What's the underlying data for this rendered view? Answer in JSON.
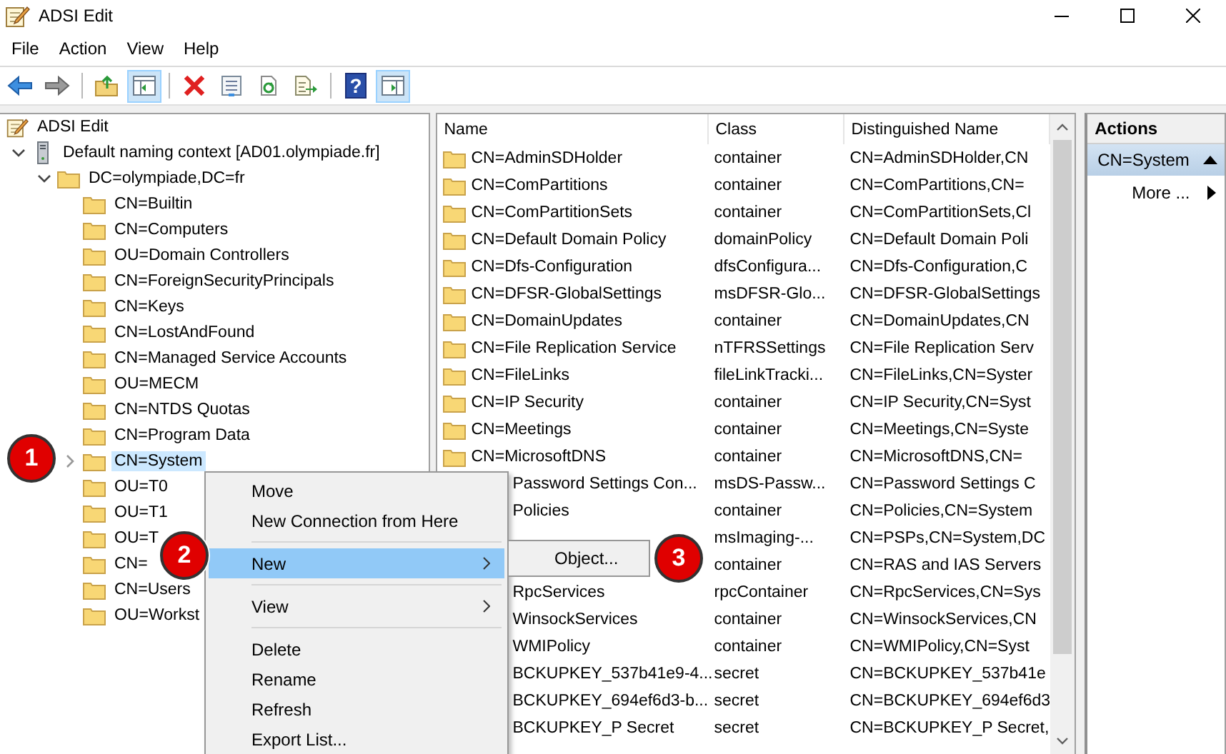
{
  "window": {
    "title": "ADSI Edit"
  },
  "menu_bar": [
    "File",
    "Action",
    "View",
    "Help"
  ],
  "toolbar": [
    {
      "kind": "back",
      "pressed": false
    },
    {
      "kind": "forward",
      "pressed": false
    },
    {
      "kind": "separator"
    },
    {
      "kind": "up",
      "pressed": false
    },
    {
      "kind": "console-tree",
      "pressed": true
    },
    {
      "kind": "separator"
    },
    {
      "kind": "delete",
      "pressed": false
    },
    {
      "kind": "properties",
      "pressed": false
    },
    {
      "kind": "refresh",
      "pressed": false
    },
    {
      "kind": "export",
      "pressed": false
    },
    {
      "kind": "separator"
    },
    {
      "kind": "help",
      "pressed": false,
      "glyph": "?"
    },
    {
      "kind": "action-pane",
      "pressed": true
    }
  ],
  "tree": {
    "items": [
      {
        "label": "ADSI Edit",
        "kind": "root",
        "selected": false,
        "children": [
          {
            "label": "Default naming context [AD01.olympiade.fr]",
            "kind": "server",
            "expanded": true,
            "selected": false,
            "children": [
              {
                "label": "DC=olympiade,DC=fr",
                "kind": "folder",
                "expanded": true,
                "selected": false,
                "children": [
                  {
                    "label": "CN=Builtin",
                    "kind": "folder",
                    "selected": false
                  },
                  {
                    "label": "CN=Computers",
                    "kind": "folder",
                    "selected": false
                  },
                  {
                    "label": "OU=Domain Controllers",
                    "kind": "folder",
                    "selected": false
                  },
                  {
                    "label": "CN=ForeignSecurityPrincipals",
                    "kind": "folder",
                    "selected": false
                  },
                  {
                    "label": "CN=Keys",
                    "kind": "folder",
                    "selected": false
                  },
                  {
                    "label": "CN=LostAndFound",
                    "kind": "folder",
                    "selected": false
                  },
                  {
                    "label": "CN=Managed Service Accounts",
                    "kind": "folder",
                    "selected": false
                  },
                  {
                    "label": "OU=MECM",
                    "kind": "folder",
                    "selected": false
                  },
                  {
                    "label": "CN=NTDS Quotas",
                    "kind": "folder",
                    "selected": false
                  },
                  {
                    "label": "CN=Program Data",
                    "kind": "folder",
                    "selected": false
                  },
                  {
                    "label": "CN=System",
                    "kind": "folder",
                    "expanded": false,
                    "selected": true
                  },
                  {
                    "label": "OU=T0",
                    "kind": "folder",
                    "selected": false
                  },
                  {
                    "label": "OU=T1",
                    "kind": "folder",
                    "selected": false
                  },
                  {
                    "label": "OU=T",
                    "kind": "folder",
                    "selected": false
                  },
                  {
                    "label": "CN=",
                    "kind": "folder",
                    "selected": false
                  },
                  {
                    "label": "CN=Users",
                    "kind": "folder",
                    "selected": false
                  },
                  {
                    "label": "OU=Workst",
                    "kind": "folder",
                    "selected": false
                  }
                ]
              }
            ]
          }
        ]
      }
    ]
  },
  "list": {
    "columns": [
      "Name",
      "Class",
      "Distinguished Name"
    ],
    "rows": [
      {
        "kind": "folder",
        "name": "CN=AdminSDHolder",
        "class": "container",
        "dn": "CN=AdminSDHolder,CN"
      },
      {
        "kind": "folder",
        "name": "CN=ComPartitions",
        "class": "container",
        "dn": "CN=ComPartitions,CN="
      },
      {
        "kind": "folder",
        "name": "CN=ComPartitionSets",
        "class": "container",
        "dn": "CN=ComPartitionSets,Cl"
      },
      {
        "kind": "folder",
        "name": "CN=Default Domain Policy",
        "class": "domainPolicy",
        "dn": "CN=Default Domain Poli"
      },
      {
        "kind": "folder",
        "name": "CN=Dfs-Configuration",
        "class": "dfsConfigura...",
        "dn": "CN=Dfs-Configuration,C"
      },
      {
        "kind": "folder",
        "name": "CN=DFSR-GlobalSettings",
        "class": "msDFSR-Glo...",
        "dn": "CN=DFSR-GlobalSettings"
      },
      {
        "kind": "folder",
        "name": "CN=DomainUpdates",
        "class": "container",
        "dn": "CN=DomainUpdates,CN"
      },
      {
        "kind": "folder",
        "name": "CN=File Replication Service",
        "class": "nTFRSSettings",
        "dn": "CN=File Replication Serv"
      },
      {
        "kind": "folder",
        "name": "CN=FileLinks",
        "class": "fileLinkTracki...",
        "dn": "CN=FileLinks,CN=Syster"
      },
      {
        "kind": "folder",
        "name": "CN=IP Security",
        "class": "container",
        "dn": "CN=IP Security,CN=Syst"
      },
      {
        "kind": "folder",
        "name": "CN=Meetings",
        "class": "container",
        "dn": "CN=Meetings,CN=Syste"
      },
      {
        "kind": "folder",
        "name": "CN=MicrosoftDNS",
        "class": "container",
        "dn": "CN=MicrosoftDNS,CN="
      },
      {
        "kind": "covered",
        "name": "Password Settings Con...",
        "class": "msDS-Passw...",
        "dn": "CN=Password Settings C"
      },
      {
        "kind": "covered",
        "name": "Policies",
        "class": "container",
        "dn": "CN=Policies,CN=System"
      },
      {
        "kind": "hidden",
        "class": "msImaging-...",
        "dn": "CN=PSPs,CN=System,DC"
      },
      {
        "kind": "hidden",
        "class": "container",
        "dn": "CN=RAS and IAS Servers"
      },
      {
        "kind": "covered",
        "name": "RpcServices",
        "class": "rpcContainer",
        "dn": "CN=RpcServices,CN=Sys"
      },
      {
        "kind": "covered",
        "name": "WinsockServices",
        "class": "container",
        "dn": "CN=WinsockServices,CN"
      },
      {
        "kind": "covered",
        "name": "WMIPolicy",
        "class": "container",
        "dn": "CN=WMIPolicy,CN=Syst"
      },
      {
        "kind": "covered",
        "name": "BCKUPKEY_537b41e9-4...",
        "class": "secret",
        "dn": "CN=BCKUPKEY_537b41e"
      },
      {
        "kind": "covered",
        "name": "BCKUPKEY_694ef6d3-b...",
        "class": "secret",
        "dn": "CN=BCKUPKEY_694ef6d3"
      },
      {
        "kind": "covered",
        "name": "BCKUPKEY_P Secret",
        "class": "secret",
        "dn": "CN=BCKUPKEY_P Secret,"
      }
    ]
  },
  "actions": {
    "title": "Actions",
    "sections": [
      {
        "label": "CN=System",
        "expanded": true,
        "items": [
          "More ..."
        ]
      }
    ]
  },
  "context_menu": {
    "items": [
      {
        "kind": "item",
        "label": "Move",
        "selected": false
      },
      {
        "kind": "item",
        "label": "New Connection from Here",
        "selected": false
      },
      {
        "kind": "separator"
      },
      {
        "kind": "submenu",
        "label": "New",
        "selected": true
      },
      {
        "kind": "separator"
      },
      {
        "kind": "submenu",
        "label": "View",
        "selected": false
      },
      {
        "kind": "separator"
      },
      {
        "kind": "item",
        "label": "Delete",
        "selected": false
      },
      {
        "kind": "item",
        "label": "Rename",
        "selected": false
      },
      {
        "kind": "item",
        "label": "Refresh",
        "selected": false
      },
      {
        "kind": "item",
        "label": "Export List...",
        "selected": false
      }
    ],
    "submenu": {
      "items": [
        {
          "label": "Object...",
          "selected": false
        }
      ]
    }
  },
  "step_badges": [
    {
      "label": "1"
    },
    {
      "label": "2"
    },
    {
      "label": "3"
    }
  ]
}
